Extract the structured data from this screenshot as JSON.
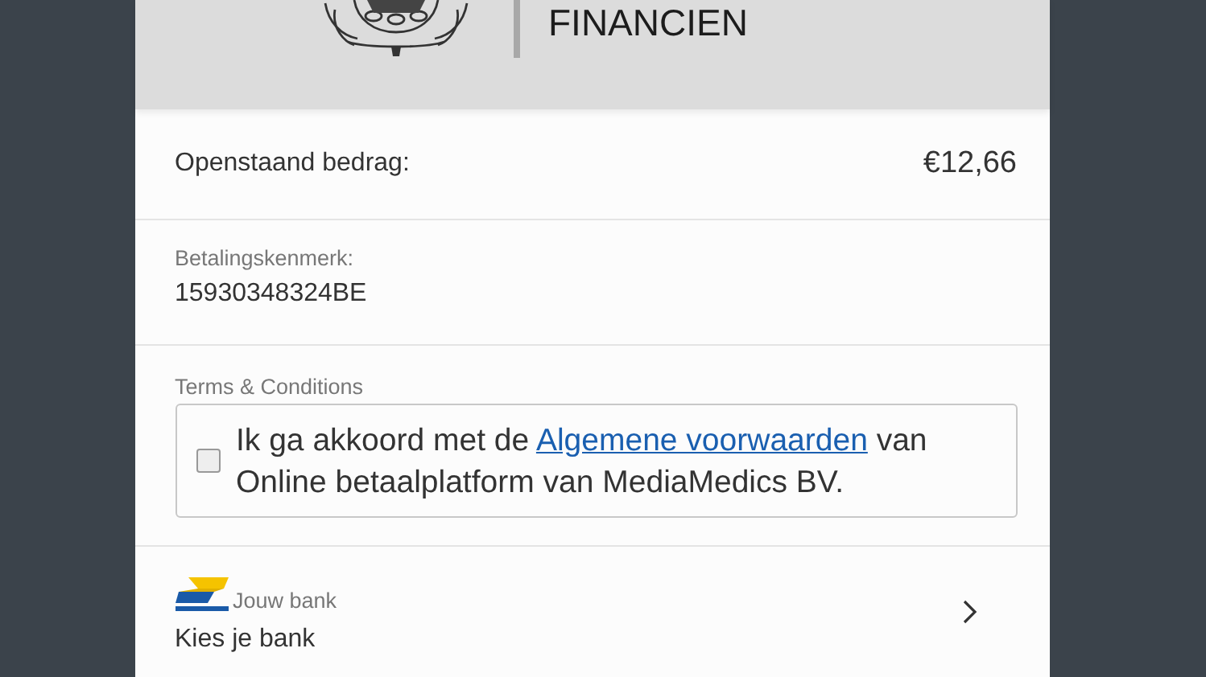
{
  "header": {
    "title": "FINANCIEN"
  },
  "amount": {
    "label": "Openstaand bedrag:",
    "value": "€12,66"
  },
  "reference": {
    "label": "Betalingskenmerk:",
    "value": "15930348324BE"
  },
  "terms": {
    "label": "Terms & Conditions",
    "checked": false,
    "text_before": "Ik ga akkoord met de ",
    "link": "Algemene voorwaarden",
    "text_after": " van Online betaalplatform van MediaMedics BV."
  },
  "bank": {
    "label": "Jouw bank",
    "value": "Kies je bank"
  }
}
